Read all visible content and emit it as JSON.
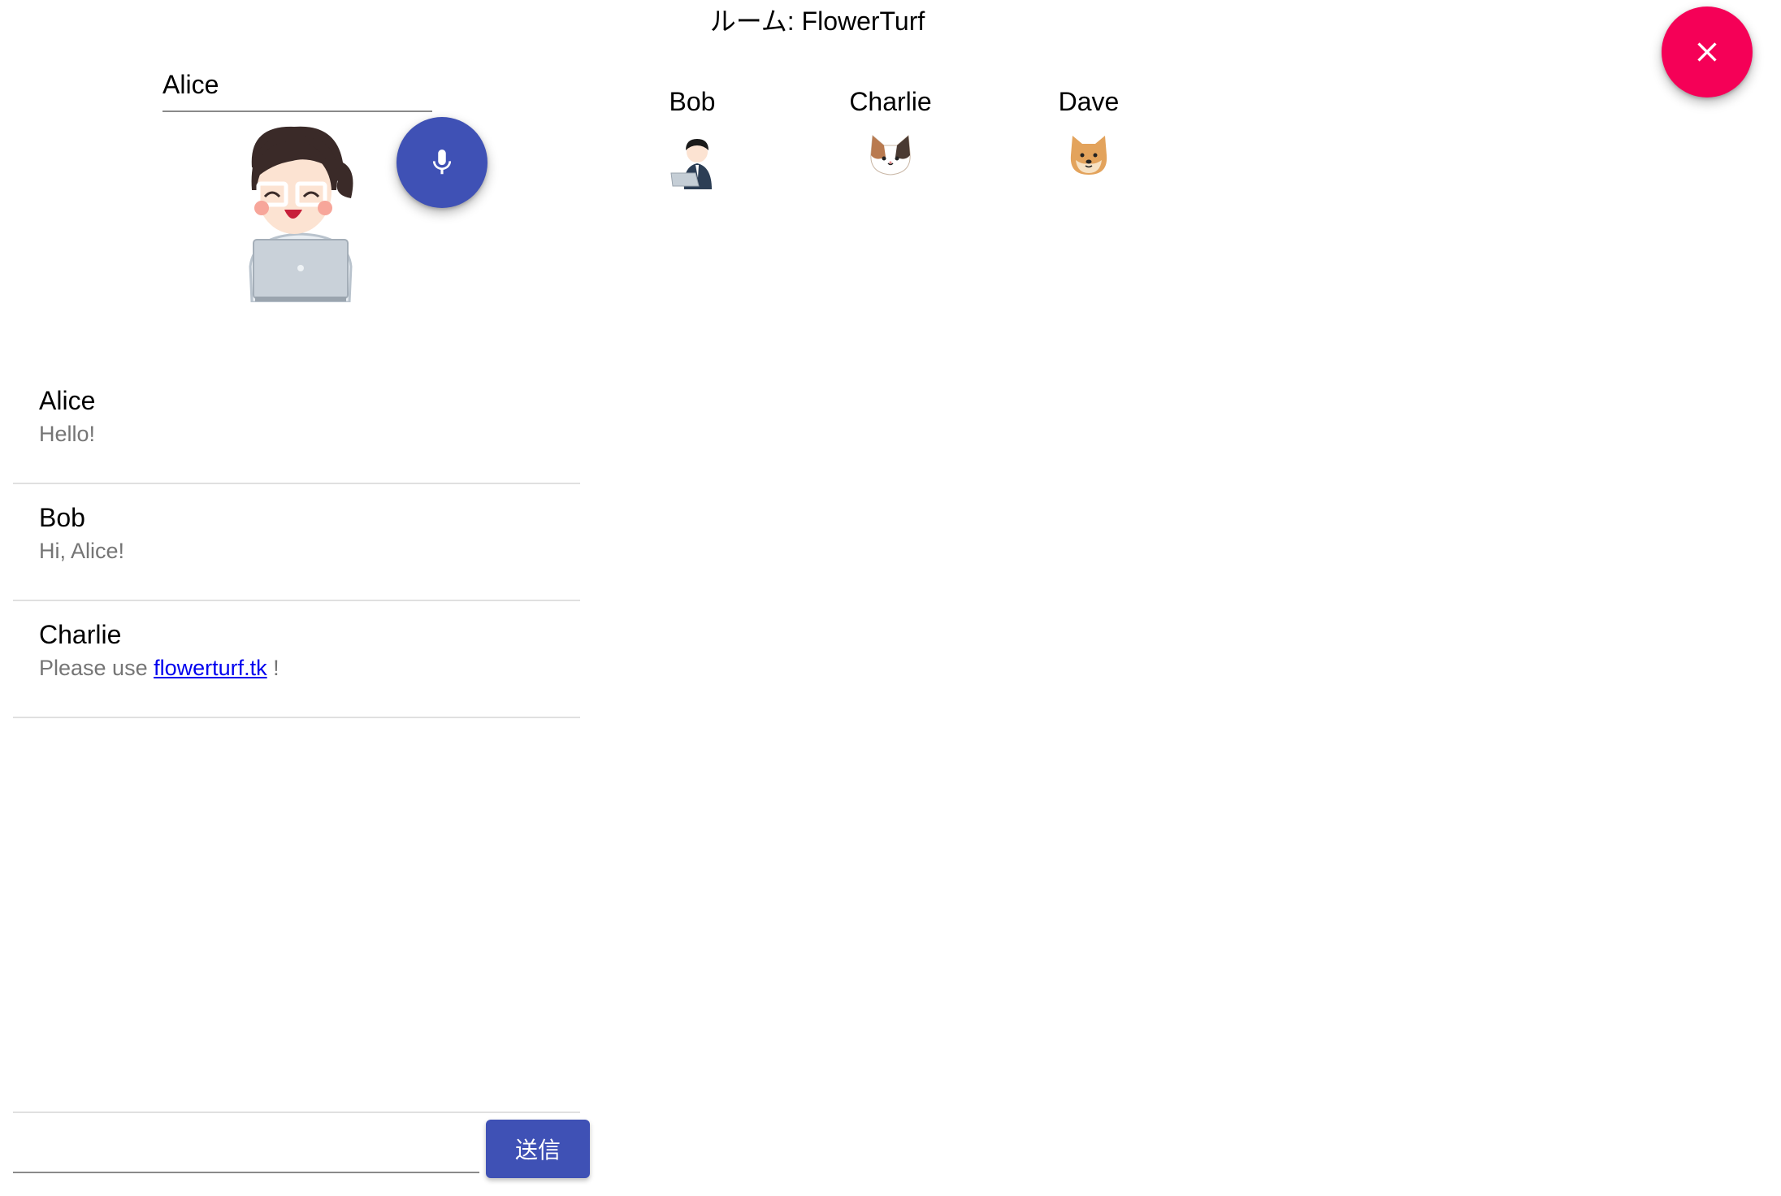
{
  "header": {
    "room_label": "ルーム: FlowerTurf"
  },
  "self": {
    "name_value": "Alice",
    "avatar": "girl-with-laptop"
  },
  "peers": [
    {
      "name": "Bob",
      "avatar": "businessman-with-laptop"
    },
    {
      "name": "Charlie",
      "avatar": "calico-cat"
    },
    {
      "name": "Dave",
      "avatar": "shiba-dog"
    }
  ],
  "messages": [
    {
      "sender": "Alice",
      "text": "Hello!"
    },
    {
      "sender": "Bob",
      "text": "Hi, Alice!"
    },
    {
      "sender": "Charlie",
      "text_before": "Please use ",
      "link_text": "flowerturf.tk",
      "text_after": " !"
    }
  ],
  "composer": {
    "value": "",
    "send_label": "送信"
  },
  "colors": {
    "primary": "#3f51b5",
    "accent": "#f50057",
    "link": "#0000ee"
  }
}
